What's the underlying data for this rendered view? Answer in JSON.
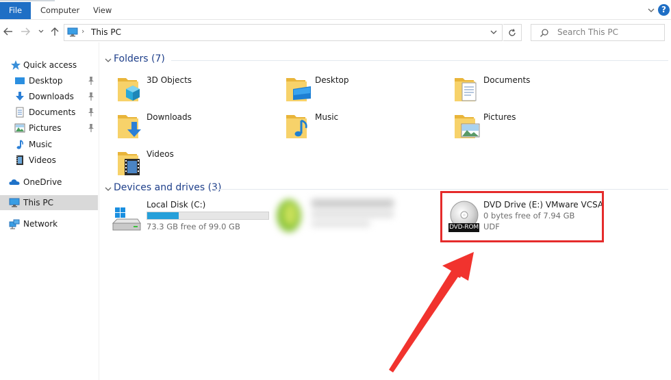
{
  "ribbon": {
    "file_tab": "File",
    "tabs": [
      "Computer",
      "View"
    ],
    "help_glyph": "?"
  },
  "address_bar": {
    "path": "This PC",
    "separator": "›",
    "search_placeholder": "Search This PC"
  },
  "sidebar": {
    "items": [
      {
        "label": "Quick access",
        "icon": "star-icon"
      },
      {
        "label": "Desktop",
        "icon": "desktop-icon",
        "pinned": true
      },
      {
        "label": "Downloads",
        "icon": "download-icon",
        "pinned": true
      },
      {
        "label": "Documents",
        "icon": "documents-icon",
        "pinned": true
      },
      {
        "label": "Pictures",
        "icon": "pictures-icon",
        "pinned": true
      },
      {
        "label": "Music",
        "icon": "music-icon"
      },
      {
        "label": "Videos",
        "icon": "videos-icon"
      },
      {
        "label": "OneDrive",
        "icon": "cloud-icon"
      },
      {
        "label": "This PC",
        "icon": "computer-icon",
        "selected": true
      },
      {
        "label": "Network",
        "icon": "network-icon"
      }
    ]
  },
  "folders": {
    "header": "Folders (7)",
    "items": [
      {
        "name": "3D Objects"
      },
      {
        "name": "Desktop"
      },
      {
        "name": "Documents"
      },
      {
        "name": "Downloads"
      },
      {
        "name": "Music"
      },
      {
        "name": "Pictures"
      },
      {
        "name": "Videos"
      }
    ]
  },
  "drives": {
    "header": "Devices and drives (3)",
    "local": {
      "name": "Local Disk (C:)",
      "free_text": "73.3 GB free of 99.0 GB",
      "used_fraction": 0.26
    },
    "dvd": {
      "name": "DVD Drive (E:) VMware VCSA",
      "free_text": "0 bytes free of 7.94 GB",
      "fs": "UDF",
      "badge": "DVD-ROM"
    }
  },
  "colors": {
    "accent": "#1f6fc5",
    "highlight": "#e52b2b",
    "folder": "#f4c542",
    "bar_fill": "#26a0da"
  }
}
